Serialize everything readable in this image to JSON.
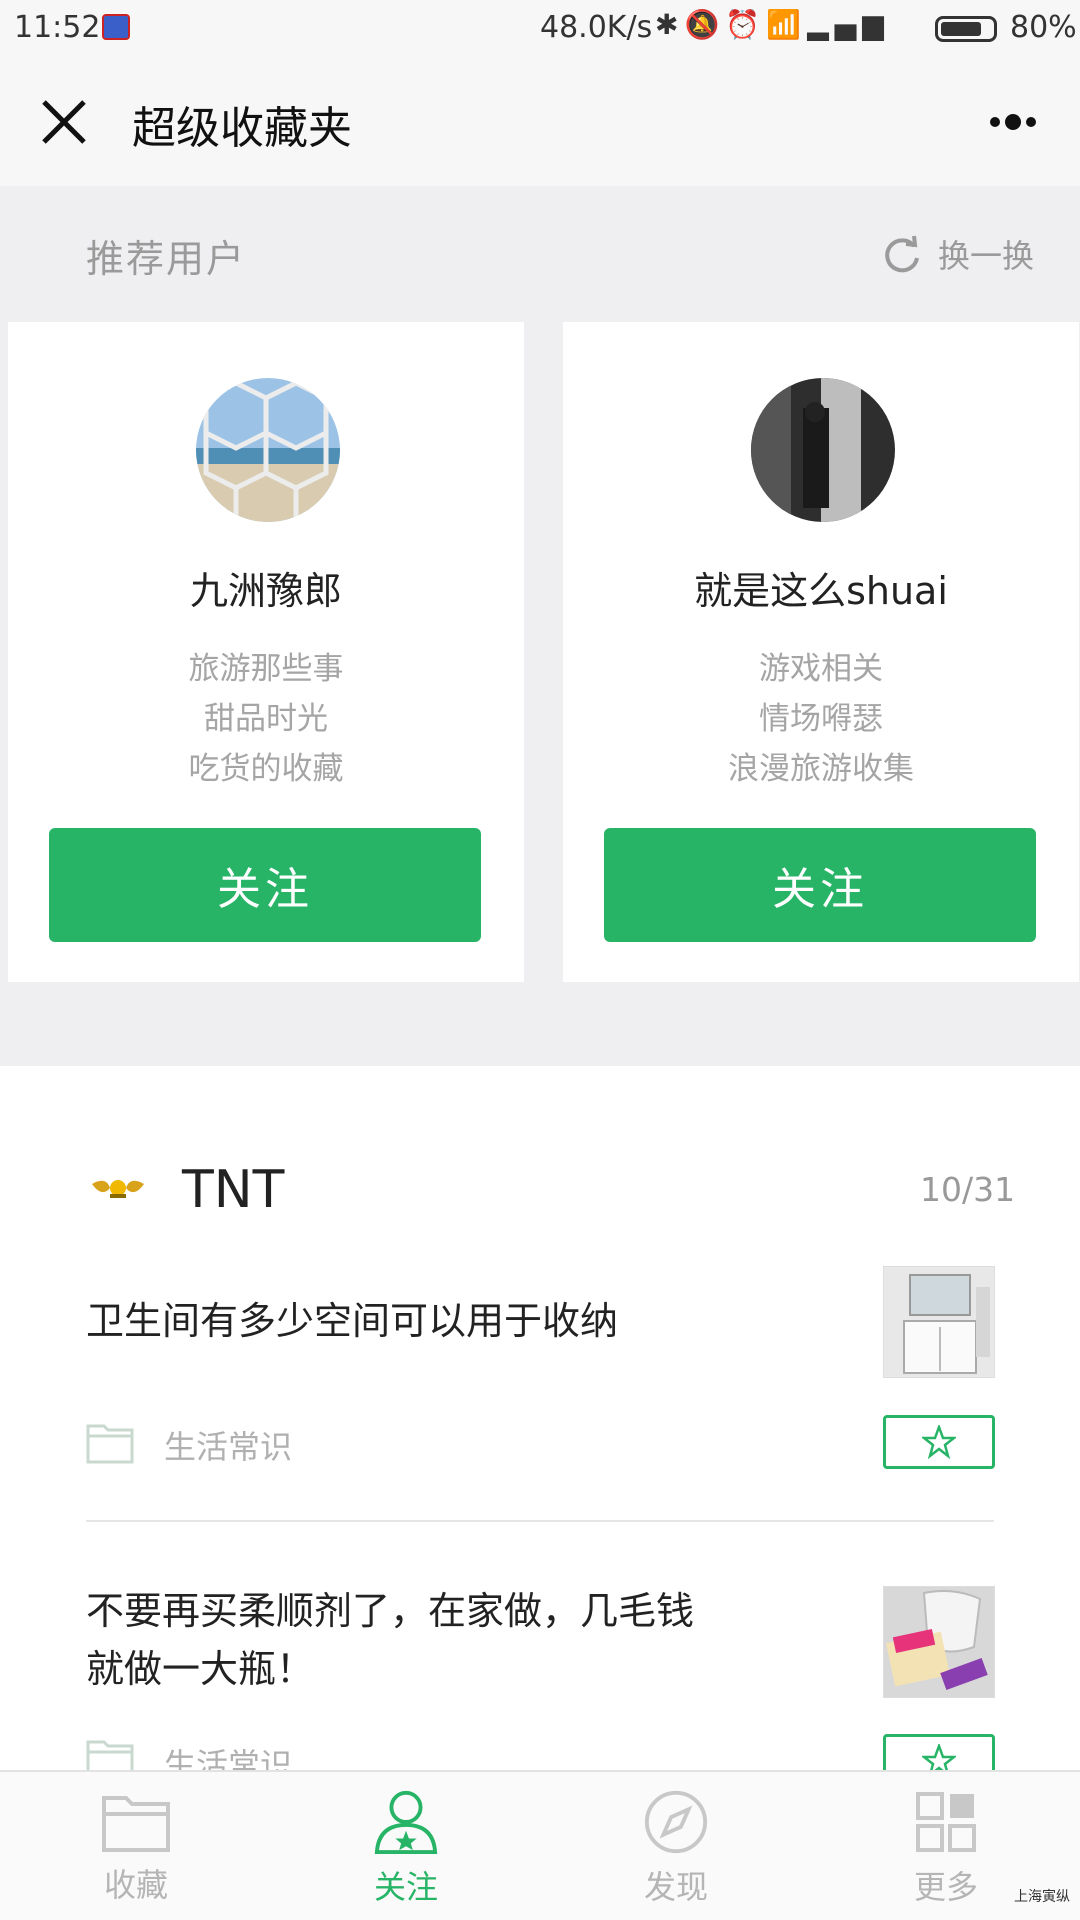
{
  "status_bar": {
    "time": "11:52",
    "speed": "48.0K/s",
    "battery": "80%",
    "battery_level": 0.8
  },
  "header": {
    "title": "超级收藏夹"
  },
  "recommend": {
    "title": "推荐用户",
    "refresh_label": "换一换",
    "users": [
      {
        "name": "九洲豫郎",
        "tags": [
          "旅游那些事",
          "甜品时光",
          "吃货的收藏"
        ],
        "follow_label": "关注"
      },
      {
        "name": "就是这么shuai",
        "tags": [
          "游戏相关",
          "情场嘚瑟",
          "浪漫旅游收集"
        ],
        "follow_label": "关注"
      }
    ]
  },
  "feed": {
    "user_name": "TNT",
    "date": "10/31",
    "items": [
      {
        "title": "卫生间有多少空间可以用于收纳",
        "category": "生活常识"
      },
      {
        "title_line1": "不要再买柔顺剂了，在家做，几毛钱",
        "title_line2": "就做一大瓶！",
        "category": "生活常识"
      }
    ]
  },
  "bottom_nav": {
    "items": [
      "收藏",
      "关注",
      "发现",
      "更多"
    ],
    "active": "关注"
  },
  "watermark": "上海寅纵",
  "colors": {
    "accent": "#28b467",
    "background_section": "#efeff1",
    "muted_text": "#a5a5a5"
  }
}
